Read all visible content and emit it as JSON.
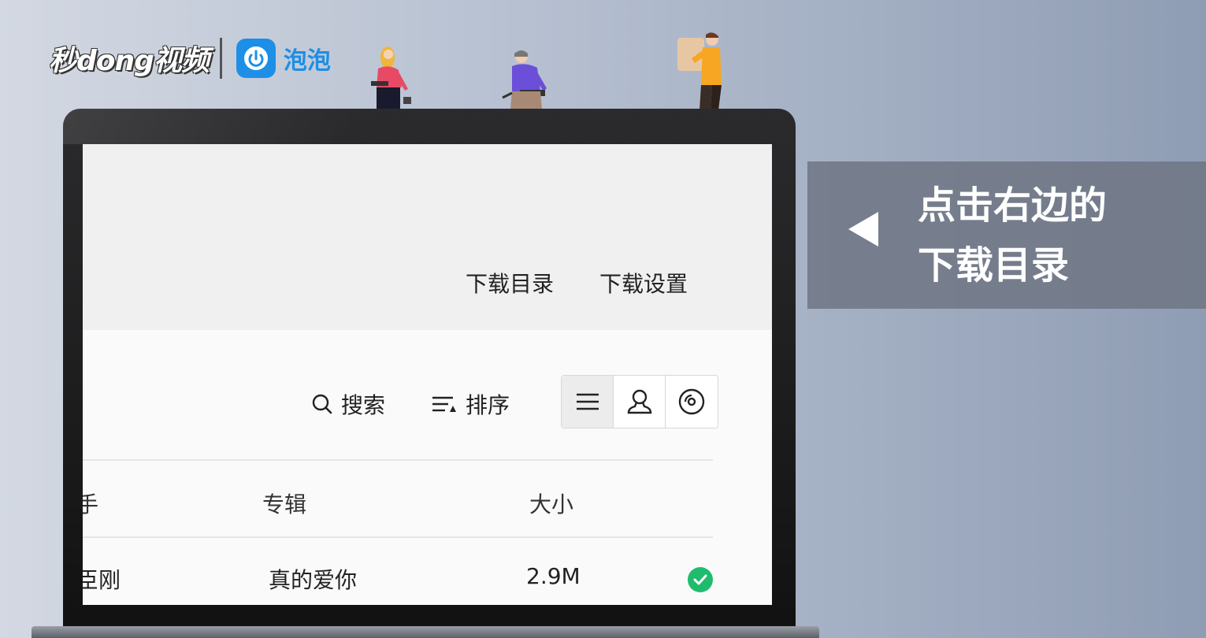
{
  "brand": {
    "logo_text": "秒dong视频",
    "partner_text": "泡泡",
    "partner_icon": "power-icon",
    "accent_color": "#1e8fe6"
  },
  "toolbar": {
    "download_dir_label": "下载目录",
    "download_settings_label": "下载设置",
    "search_label": "搜索",
    "sort_label": "排序",
    "view_icons": [
      "list-view-icon",
      "singer-view-icon",
      "album-view-icon"
    ]
  },
  "table": {
    "headers": {
      "singer": "手",
      "album": "专辑",
      "size": "大小"
    },
    "rows": [
      {
        "singer": "臣刚",
        "album": "真的爱你",
        "size": "2.9M",
        "status": "downloaded",
        "status_color": "#1fbc6d"
      }
    ]
  },
  "callout": {
    "line1": "点击右边的",
    "line2": "下载目录"
  }
}
